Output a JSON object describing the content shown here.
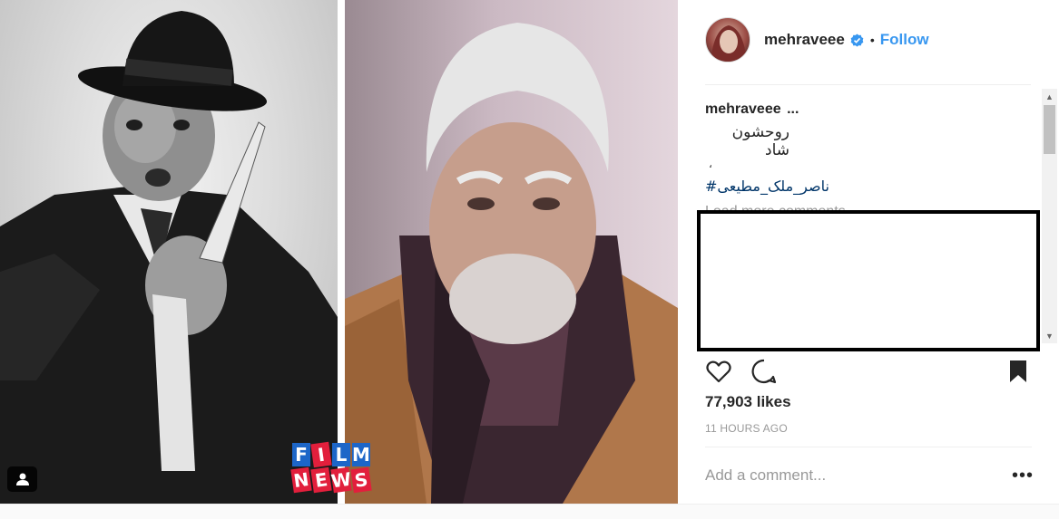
{
  "post": {
    "author": "mehraveee",
    "follow_label": "Follow",
    "dot": "•",
    "caption_user": "mehraveee",
    "caption_more": "...",
    "caption_text": "روحشون شاد",
    "caption_mark": "،",
    "hashtag": "#ناصر_ملک_مطیعی",
    "load_more": "Load more comments",
    "likes": "77,903 likes",
    "time": "11 HOURS AGO",
    "add_comment_placeholder": "Add a comment...",
    "more_options": "•••"
  },
  "photo": {
    "logo_row1": [
      "F",
      "I",
      "L",
      "M"
    ],
    "logo_row2": [
      "N",
      "E",
      "W",
      "S"
    ]
  },
  "icons": {
    "verified": "verified-badge-icon",
    "like": "heart-icon",
    "comment": "comment-icon",
    "save": "bookmark-icon",
    "tag": "user-tag-icon"
  },
  "colors": {
    "link": "#3897f0",
    "hashtag": "#003569",
    "muted": "#999999",
    "logo_blue": "#1d66c8",
    "logo_red": "#e21f3c"
  }
}
